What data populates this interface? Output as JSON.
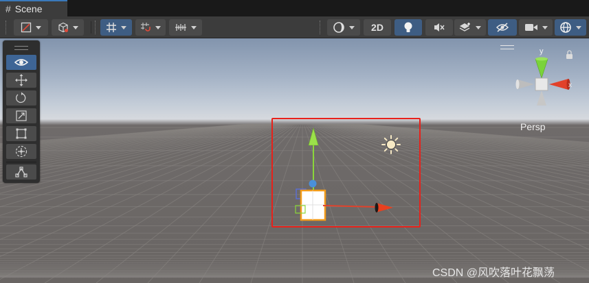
{
  "tab": {
    "title": "Scene",
    "icon": "hash-grid-icon"
  },
  "toolbar": {
    "left": [
      {
        "name": "draw-mode-button",
        "icon": "shading-mode-icon",
        "dropdown": true
      },
      {
        "name": "render-mode-button",
        "icon": "cube-outline-icon",
        "dropdown": true
      },
      {
        "name": "grid-toggle-button",
        "icon": "grid-icon",
        "dropdown": true,
        "active": true
      },
      {
        "name": "snap-toggle-button",
        "icon": "snap-icon",
        "dropdown": true
      },
      {
        "name": "increment-snap-button",
        "icon": "ruler-icon",
        "dropdown": true
      }
    ],
    "right": [
      {
        "name": "orientation-button",
        "icon": "circle-sphere-icon",
        "dropdown": true
      },
      {
        "name": "2d-toggle-button",
        "label": "2D"
      },
      {
        "name": "lighting-toggle-button",
        "icon": "bulb-icon",
        "active": true
      },
      {
        "name": "audio-toggle-button",
        "icon": "mute-icon"
      },
      {
        "name": "effects-button",
        "icon": "layers-icon",
        "dropdown": true
      },
      {
        "name": "hidden-toggle-button",
        "icon": "eye-slash-icon",
        "active": true
      },
      {
        "name": "camera-button",
        "icon": "camera-icon",
        "dropdown": true
      },
      {
        "name": "gizmos-button",
        "icon": "globe-icon",
        "dropdown": true,
        "active": true
      }
    ]
  },
  "tools": [
    {
      "name": "view-tool",
      "icon": "eye-icon",
      "active": true
    },
    {
      "name": "move-tool",
      "icon": "move-arrows-icon"
    },
    {
      "name": "rotate-tool",
      "icon": "rotate-icon"
    },
    {
      "name": "scale-tool",
      "icon": "scale-icon"
    },
    {
      "name": "rect-tool",
      "icon": "rect-icon"
    },
    {
      "name": "transform-tool",
      "icon": "transform-icon"
    },
    {
      "name": "custom-tool",
      "icon": "path-nodes-icon"
    }
  ],
  "orientation_gizmo": {
    "y_label": "y",
    "x_label": "x",
    "projection": "Persp",
    "lock_icon": "lock-icon"
  },
  "scene": {
    "selected_object": "cube",
    "light_icon": "directional-light-icon",
    "axis_colors": {
      "x": "#e2412a",
      "y": "#8ad63a",
      "z": "#4a90d9"
    }
  },
  "highlight_color": "#e8211a",
  "watermark": "CSDN @风吹落叶花飘荡"
}
